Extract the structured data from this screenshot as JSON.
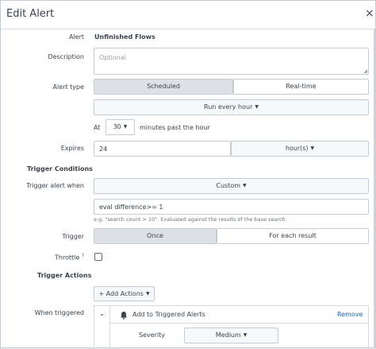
{
  "dialog": {
    "title": "Edit Alert",
    "close_glyph": "×"
  },
  "alert": {
    "label": "Alert",
    "name": "Unfinished Flows"
  },
  "description": {
    "label": "Description",
    "placeholder": "Optional"
  },
  "alert_type": {
    "label": "Alert type",
    "options": [
      "Scheduled",
      "Real-time"
    ],
    "selected": "Scheduled",
    "schedule": "Run every hour",
    "at_label": "At",
    "minute_value": "30",
    "minutes_suffix": "minutes past the hour"
  },
  "expires": {
    "label": "Expires",
    "value": "24",
    "unit": "hour(s)"
  },
  "trigger_conditions": {
    "heading": "Trigger Conditions",
    "trigger_when_label": "Trigger alert when",
    "trigger_when_value": "Custom",
    "condition": "eval difference>= 1",
    "help": "e.g. \"search count > 10\". Evaluated against the results of the base search.",
    "trigger_label": "Trigger",
    "trigger_options": [
      "Once",
      "For each result"
    ],
    "trigger_selected": "Once",
    "throttle_label": "Throttle",
    "throttle_help": "?",
    "throttle_checked": false
  },
  "trigger_actions": {
    "heading": "Trigger Actions",
    "add_actions": "+ Add Actions",
    "when_triggered_label": "When triggered",
    "action_title": "Add to Triggered Alerts",
    "remove": "Remove",
    "severity_label": "Severity",
    "severity_value": "Medium"
  },
  "icons": {
    "close": "close-icon",
    "caret": "caret-down-icon",
    "bell": "bell-icon",
    "chevron": "chevron-down-icon"
  },
  "colors": {
    "link": "#1a63b5",
    "selected_segment": "#dde1e6",
    "border": "#c3cbd4"
  }
}
